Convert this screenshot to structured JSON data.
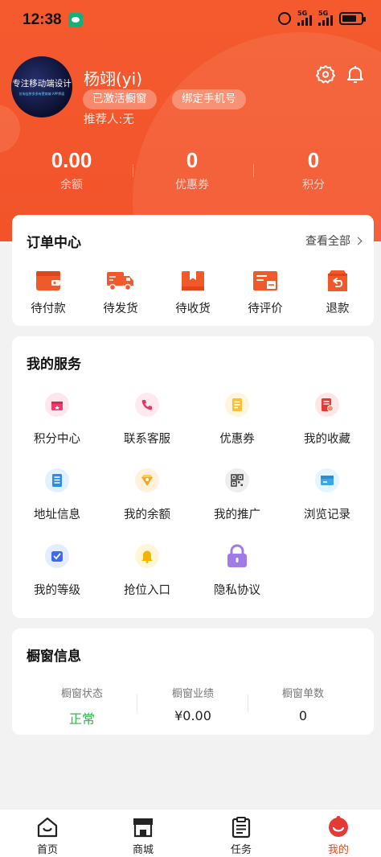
{
  "status_bar": {
    "time": "12:38",
    "network": "5G"
  },
  "profile": {
    "username": "杨翊(yi)",
    "tag1": "已激活橱窗",
    "tag2": "绑定手机号",
    "referrer": "推荐人:无",
    "avatar_text": "专注移动端设计",
    "avatar_subtext": "仿淘宝拼多多有赞商城 APP界面"
  },
  "stats": [
    {
      "value": "0.00",
      "label": "余额"
    },
    {
      "value": "0",
      "label": "优惠券"
    },
    {
      "value": "0",
      "label": "积分"
    }
  ],
  "orders": {
    "title": "订单中心",
    "view_all": "查看全部",
    "items": [
      {
        "label": "待付款",
        "icon": "wallet-icon"
      },
      {
        "label": "待发货",
        "icon": "truck-icon"
      },
      {
        "label": "待收货",
        "icon": "package-icon"
      },
      {
        "label": "待评价",
        "icon": "review-card-icon"
      },
      {
        "label": "退款",
        "icon": "refund-icon"
      }
    ]
  },
  "services": {
    "title": "我的服务",
    "items": [
      {
        "label": "积分中心",
        "icon": "gift-icon"
      },
      {
        "label": "联系客服",
        "icon": "phone-icon"
      },
      {
        "label": "优惠券",
        "icon": "coupon-icon"
      },
      {
        "label": "我的收藏",
        "icon": "favorite-doc-icon"
      },
      {
        "label": "地址信息",
        "icon": "address-icon"
      },
      {
        "label": "我的余额",
        "icon": "balance-icon"
      },
      {
        "label": "我的推广",
        "icon": "qrcode-icon"
      },
      {
        "label": "浏览记录",
        "icon": "history-icon"
      },
      {
        "label": "我的等级",
        "icon": "level-icon"
      },
      {
        "label": "抢位入口",
        "icon": "bell-icon"
      },
      {
        "label": "隐私协议",
        "icon": "lock-icon"
      }
    ]
  },
  "showcase": {
    "title": "橱窗信息",
    "items": [
      {
        "label": "橱窗状态",
        "value": "正常"
      },
      {
        "label": "橱窗业绩",
        "value": "¥0.00"
      },
      {
        "label": "橱窗单数",
        "value": "0"
      }
    ]
  },
  "tabbar": [
    {
      "label": "首页",
      "icon": "home-icon"
    },
    {
      "label": "商城",
      "icon": "store-icon"
    },
    {
      "label": "任务",
      "icon": "task-icon"
    },
    {
      "label": "我的",
      "icon": "profile-icon",
      "active": true
    }
  ],
  "colors": {
    "brand": "#f2532a",
    "success": "#2db84d",
    "tab_active": "#e64a19"
  }
}
